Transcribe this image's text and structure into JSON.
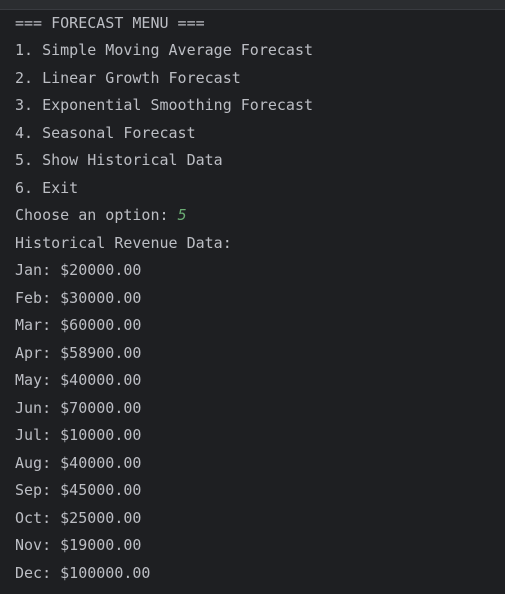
{
  "console": {
    "header": "=== FORECAST MENU ===",
    "menu": [
      "1. Simple Moving Average Forecast",
      "2. Linear Growth Forecast",
      "3. Exponential Smoothing Forecast",
      "4. Seasonal Forecast",
      "5. Show Historical Data",
      "6. Exit"
    ],
    "prompt": "Choose an option: ",
    "user_input": "5",
    "data_title": "Historical Revenue Data:",
    "data": [
      "Jan: $20000.00",
      "Feb: $30000.00",
      "Mar: $60000.00",
      "Apr: $58900.00",
      "May: $40000.00",
      "Jun: $70000.00",
      "Jul: $10000.00",
      "Aug: $40000.00",
      "Sep: $45000.00",
      "Oct: $25000.00",
      "Nov: $19000.00",
      "Dec: $100000.00"
    ],
    "colors": {
      "background": "#1e1f22",
      "text": "#bcbec4",
      "input": "#6aab73"
    }
  }
}
